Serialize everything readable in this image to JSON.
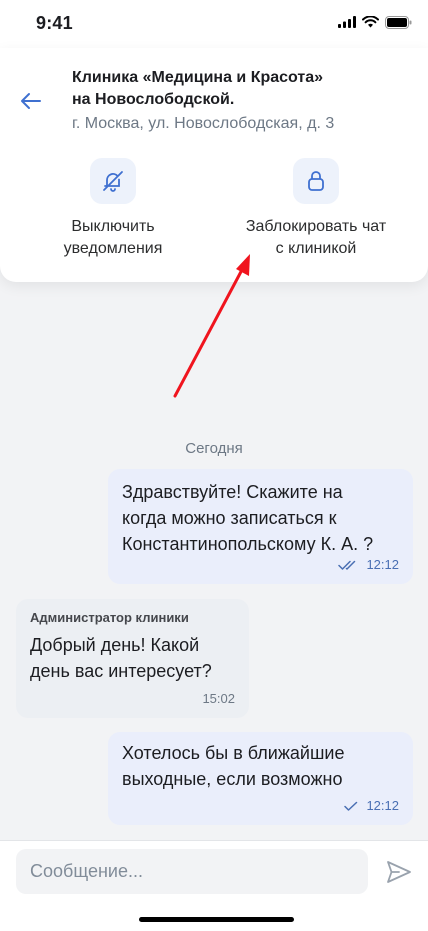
{
  "status_bar": {
    "time": "9:41"
  },
  "header": {
    "title_line1": "Клиника «Медицина и Красота»",
    "title_line2": "на Новослободской.",
    "address": "г. Москва, ул. Новослободская, д. 3"
  },
  "actions": [
    {
      "line1": "Выключить",
      "line2": "уведомления",
      "icon": "bell-off-icon"
    },
    {
      "line1": "Заблокировать чат",
      "line2": "с клиникой",
      "icon": "lock-icon"
    }
  ],
  "chat": {
    "date_separator": "Сегодня",
    "messages": [
      {
        "direction": "outgoing",
        "lines": [
          "Здравствуйте! Скажите на",
          "когда можно записаться к",
          "Константинопольскому К. А. ?"
        ],
        "time": "12:12",
        "status": "read"
      },
      {
        "direction": "incoming",
        "sender": "Администратор клиники",
        "lines": [
          "Добрый день! Какой",
          "день вас интересует?"
        ],
        "time": "15:02"
      },
      {
        "direction": "outgoing",
        "lines": [
          "Хотелось бы в ближайшие",
          "выходные, если возможно"
        ],
        "time": "12:12",
        "status": "sent"
      }
    ]
  },
  "composer": {
    "placeholder": "Сообщение...",
    "value": ""
  },
  "colors": {
    "accent": "#3f70d0",
    "outgoing_bubble": "#eaeefb",
    "incoming_bubble": "#eceff3",
    "annotation_arrow": "#f0141e"
  }
}
